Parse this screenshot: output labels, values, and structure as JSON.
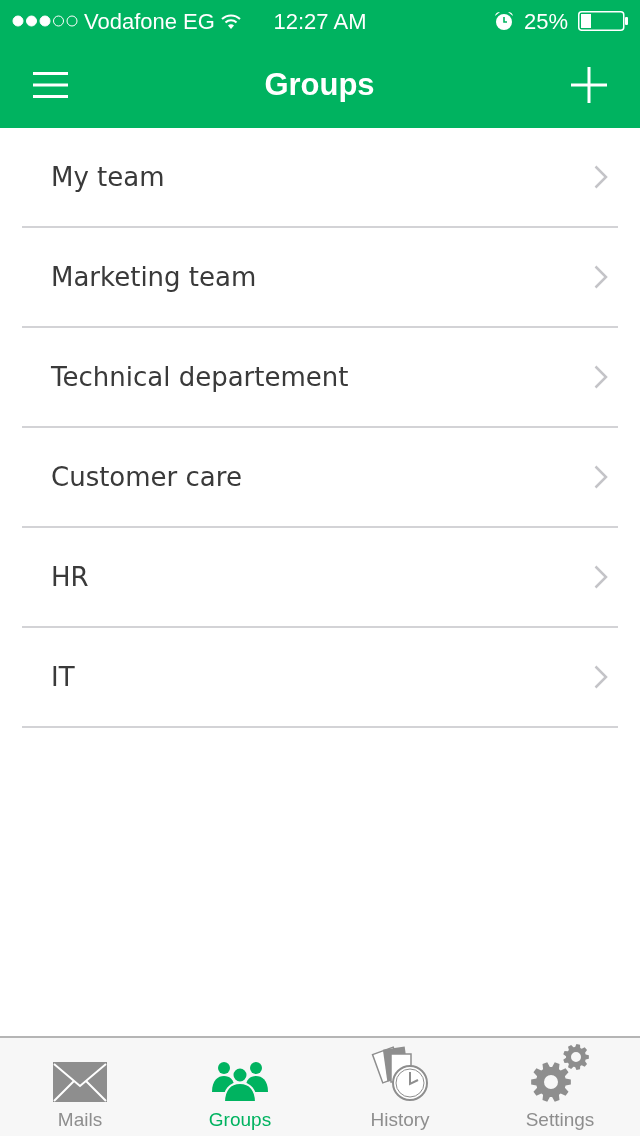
{
  "status_bar": {
    "carrier": "Vodafone EG",
    "time": "12:27 AM",
    "battery": "25%"
  },
  "header": {
    "title": "Groups"
  },
  "groups": [
    {
      "name": "My team"
    },
    {
      "name": "Marketing team"
    },
    {
      "name": "Technical departement"
    },
    {
      "name": "Customer care"
    },
    {
      "name": "HR"
    },
    {
      "name": "IT"
    }
  ],
  "tab_bar": [
    {
      "label": "Mails",
      "kind": "mail",
      "selected": false
    },
    {
      "label": "Groups",
      "kind": "groups",
      "selected": true
    },
    {
      "label": "History",
      "kind": "history",
      "selected": false
    },
    {
      "label": "Settings",
      "kind": "settings",
      "selected": false
    }
  ]
}
